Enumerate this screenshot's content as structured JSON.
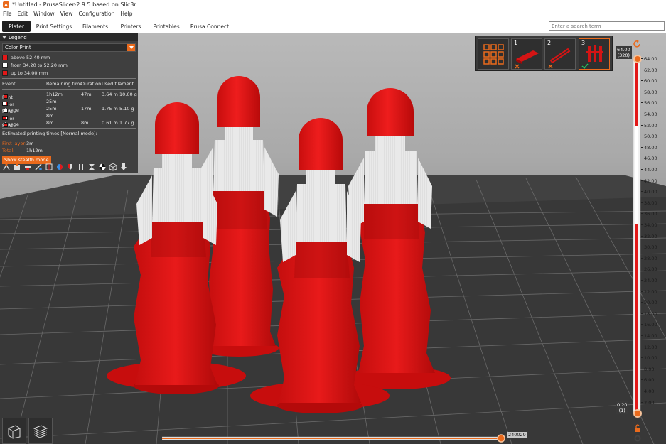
{
  "window": {
    "title": "*Untitled - PrusaSlicer-2.9.5 based on Slic3r"
  },
  "menu": [
    "File",
    "Edit",
    "Window",
    "View",
    "Configuration",
    "Help"
  ],
  "tabs": [
    "Plater",
    "Print Settings",
    "Filaments",
    "Printers",
    "Printables",
    "Prusa Connect"
  ],
  "search": {
    "placeholder": "Enter a search term"
  },
  "legend": {
    "title": "Legend",
    "view_type": "Color Print",
    "ranges": [
      {
        "label": "above 52.40 mm",
        "color": "#e21818"
      },
      {
        "label": "from 34.20 to 52.20 mm",
        "color": "#ffffff"
      },
      {
        "label": "up to 34.00 mm",
        "color": "#e21818"
      }
    ],
    "columns": [
      "Event",
      "Remaining time",
      "Duration",
      "Used filament"
    ],
    "events": [
      {
        "event": "Print",
        "swatches": [
          "#e21818"
        ],
        "remaining": "1h12m",
        "duration": "47m",
        "length": "3.64 m",
        "weight": "10.60 g"
      },
      {
        "event": "Color change",
        "swatches": [
          "#e21818",
          "#ffffff"
        ],
        "remaining": "25m",
        "duration": "",
        "length": "",
        "weight": ""
      },
      {
        "event": "Print",
        "swatches": [
          "#ffffff"
        ],
        "remaining": "25m",
        "duration": "17m",
        "length": "1.75 m",
        "weight": "5.10 g"
      },
      {
        "event": "Color change",
        "swatches": [
          "#ffffff",
          "#e21818"
        ],
        "remaining": "8m",
        "duration": "",
        "length": "",
        "weight": ""
      },
      {
        "event": "Print",
        "swatches": [
          "#e21818"
        ],
        "remaining": "8m",
        "duration": "8m",
        "length": "0.61 m",
        "weight": "1.77 g"
      }
    ],
    "estimate_label": "Estimated printing times [Normal mode]:",
    "first_layer_label": "First layer:",
    "first_layer_value": "3m",
    "total_label": "Total:",
    "total_value": "1h12m",
    "stealth_button": "Show stealth mode",
    "toolbar_icons": [
      "travel-icon",
      "wipe-icon",
      "retractions-icon",
      "deretractions-icon",
      "seams-icon",
      "tool-changes-icon",
      "color-changes-icon",
      "pause-prints-icon",
      "custom-gcodes-icon",
      "center-of-gravity-icon",
      "shells-icon",
      "tool-marker-icon"
    ]
  },
  "arrange": {
    "items": [
      "1",
      "2",
      "3"
    ],
    "selected": "3"
  },
  "layer_slider": {
    "top_value": "64.00",
    "top_layer": "(320)",
    "bottom_value": "0.20",
    "bottom_layer": "(1)",
    "ticks": [
      "64.00",
      "62.00",
      "60.00",
      "58.00",
      "56.00",
      "54.00",
      "52.00",
      "50.00",
      "48.00",
      "46.00",
      "44.00",
      "42.00",
      "40.00",
      "38.00",
      "36.00",
      "34.00",
      "32.00",
      "30.00",
      "28.00",
      "26.00",
      "24.00",
      "22.00",
      "20.00",
      "18.00",
      "16.00",
      "14.00",
      "12.00",
      "10.00",
      "8.00",
      "6.00",
      "4.00",
      "2.00"
    ]
  },
  "move_slider": {
    "value": "240029"
  },
  "colors": {
    "accent": "#ea6a1c",
    "filament_red": "#e21818",
    "filament_white": "#ffffff"
  }
}
